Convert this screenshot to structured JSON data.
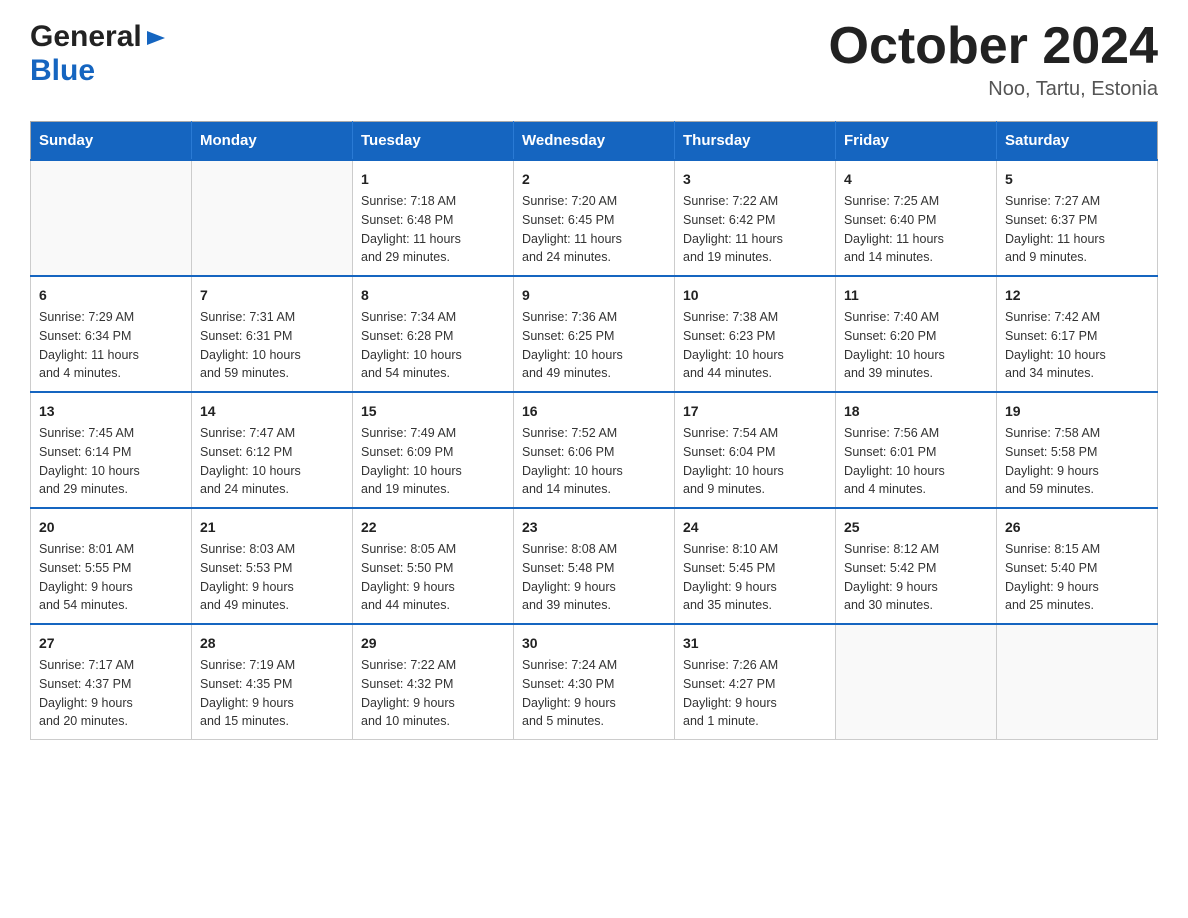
{
  "header": {
    "logo_general": "General",
    "logo_blue": "Blue",
    "month_title": "October 2024",
    "location": "Noo, Tartu, Estonia"
  },
  "days_of_week": [
    "Sunday",
    "Monday",
    "Tuesday",
    "Wednesday",
    "Thursday",
    "Friday",
    "Saturday"
  ],
  "weeks": [
    [
      {
        "day": "",
        "info": ""
      },
      {
        "day": "",
        "info": ""
      },
      {
        "day": "1",
        "info": "Sunrise: 7:18 AM\nSunset: 6:48 PM\nDaylight: 11 hours\nand 29 minutes."
      },
      {
        "day": "2",
        "info": "Sunrise: 7:20 AM\nSunset: 6:45 PM\nDaylight: 11 hours\nand 24 minutes."
      },
      {
        "day": "3",
        "info": "Sunrise: 7:22 AM\nSunset: 6:42 PM\nDaylight: 11 hours\nand 19 minutes."
      },
      {
        "day": "4",
        "info": "Sunrise: 7:25 AM\nSunset: 6:40 PM\nDaylight: 11 hours\nand 14 minutes."
      },
      {
        "day": "5",
        "info": "Sunrise: 7:27 AM\nSunset: 6:37 PM\nDaylight: 11 hours\nand 9 minutes."
      }
    ],
    [
      {
        "day": "6",
        "info": "Sunrise: 7:29 AM\nSunset: 6:34 PM\nDaylight: 11 hours\nand 4 minutes."
      },
      {
        "day": "7",
        "info": "Sunrise: 7:31 AM\nSunset: 6:31 PM\nDaylight: 10 hours\nand 59 minutes."
      },
      {
        "day": "8",
        "info": "Sunrise: 7:34 AM\nSunset: 6:28 PM\nDaylight: 10 hours\nand 54 minutes."
      },
      {
        "day": "9",
        "info": "Sunrise: 7:36 AM\nSunset: 6:25 PM\nDaylight: 10 hours\nand 49 minutes."
      },
      {
        "day": "10",
        "info": "Sunrise: 7:38 AM\nSunset: 6:23 PM\nDaylight: 10 hours\nand 44 minutes."
      },
      {
        "day": "11",
        "info": "Sunrise: 7:40 AM\nSunset: 6:20 PM\nDaylight: 10 hours\nand 39 minutes."
      },
      {
        "day": "12",
        "info": "Sunrise: 7:42 AM\nSunset: 6:17 PM\nDaylight: 10 hours\nand 34 minutes."
      }
    ],
    [
      {
        "day": "13",
        "info": "Sunrise: 7:45 AM\nSunset: 6:14 PM\nDaylight: 10 hours\nand 29 minutes."
      },
      {
        "day": "14",
        "info": "Sunrise: 7:47 AM\nSunset: 6:12 PM\nDaylight: 10 hours\nand 24 minutes."
      },
      {
        "day": "15",
        "info": "Sunrise: 7:49 AM\nSunset: 6:09 PM\nDaylight: 10 hours\nand 19 minutes."
      },
      {
        "day": "16",
        "info": "Sunrise: 7:52 AM\nSunset: 6:06 PM\nDaylight: 10 hours\nand 14 minutes."
      },
      {
        "day": "17",
        "info": "Sunrise: 7:54 AM\nSunset: 6:04 PM\nDaylight: 10 hours\nand 9 minutes."
      },
      {
        "day": "18",
        "info": "Sunrise: 7:56 AM\nSunset: 6:01 PM\nDaylight: 10 hours\nand 4 minutes."
      },
      {
        "day": "19",
        "info": "Sunrise: 7:58 AM\nSunset: 5:58 PM\nDaylight: 9 hours\nand 59 minutes."
      }
    ],
    [
      {
        "day": "20",
        "info": "Sunrise: 8:01 AM\nSunset: 5:55 PM\nDaylight: 9 hours\nand 54 minutes."
      },
      {
        "day": "21",
        "info": "Sunrise: 8:03 AM\nSunset: 5:53 PM\nDaylight: 9 hours\nand 49 minutes."
      },
      {
        "day": "22",
        "info": "Sunrise: 8:05 AM\nSunset: 5:50 PM\nDaylight: 9 hours\nand 44 minutes."
      },
      {
        "day": "23",
        "info": "Sunrise: 8:08 AM\nSunset: 5:48 PM\nDaylight: 9 hours\nand 39 minutes."
      },
      {
        "day": "24",
        "info": "Sunrise: 8:10 AM\nSunset: 5:45 PM\nDaylight: 9 hours\nand 35 minutes."
      },
      {
        "day": "25",
        "info": "Sunrise: 8:12 AM\nSunset: 5:42 PM\nDaylight: 9 hours\nand 30 minutes."
      },
      {
        "day": "26",
        "info": "Sunrise: 8:15 AM\nSunset: 5:40 PM\nDaylight: 9 hours\nand 25 minutes."
      }
    ],
    [
      {
        "day": "27",
        "info": "Sunrise: 7:17 AM\nSunset: 4:37 PM\nDaylight: 9 hours\nand 20 minutes."
      },
      {
        "day": "28",
        "info": "Sunrise: 7:19 AM\nSunset: 4:35 PM\nDaylight: 9 hours\nand 15 minutes."
      },
      {
        "day": "29",
        "info": "Sunrise: 7:22 AM\nSunset: 4:32 PM\nDaylight: 9 hours\nand 10 minutes."
      },
      {
        "day": "30",
        "info": "Sunrise: 7:24 AM\nSunset: 4:30 PM\nDaylight: 9 hours\nand 5 minutes."
      },
      {
        "day": "31",
        "info": "Sunrise: 7:26 AM\nSunset: 4:27 PM\nDaylight: 9 hours\nand 1 minute."
      },
      {
        "day": "",
        "info": ""
      },
      {
        "day": "",
        "info": ""
      }
    ]
  ]
}
